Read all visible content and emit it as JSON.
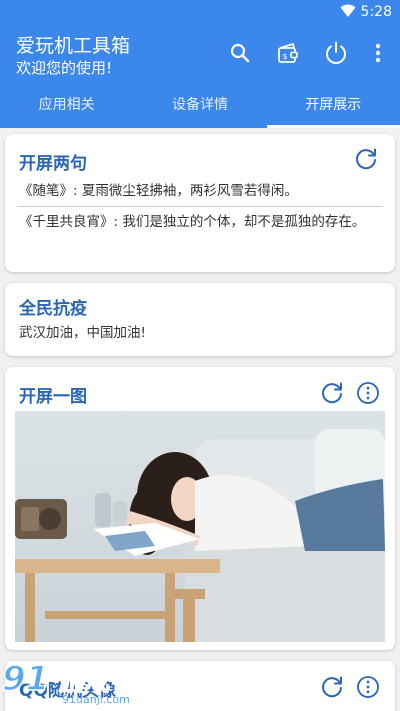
{
  "status_bar": {
    "time": "5:28"
  },
  "app_bar": {
    "title": "爱玩机工具箱",
    "subtitle": "欢迎您的使用!",
    "actions": [
      "search-icon",
      "wallet-icon",
      "power-icon",
      "more-vert-icon"
    ]
  },
  "tabs": [
    {
      "label": "应用相关",
      "active": false
    },
    {
      "label": "设备详情",
      "active": false
    },
    {
      "label": "开屏展示",
      "active": true
    }
  ],
  "card_quotes": {
    "title": "开屏两句",
    "line1": "《随笔》: 夏雨微尘轻拂袖，两衫风雪若得闲。",
    "line2": "《千里共良宵》: 我们是独立的个体，却不是孤独的存在。"
  },
  "card_fight": {
    "title": "全民抗疫",
    "text": "武汉加油，中国加油!"
  },
  "card_image": {
    "title": "开屏一图"
  },
  "card_avatar": {
    "title": "QQ随机头像"
  },
  "watermark": {
    "logo": "91游戏",
    "url": "91danji.com"
  },
  "colors": {
    "primary": "#3b87ec",
    "title_blue": "#2a65b8",
    "background": "#f0f0f0"
  }
}
